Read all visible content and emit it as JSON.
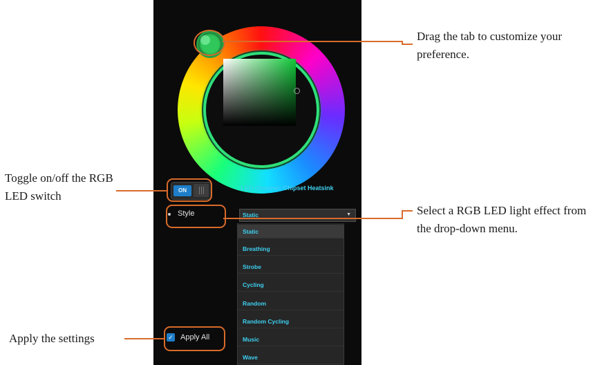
{
  "colors": {
    "panel_bg": "#0b0b0b",
    "accent": "#3ed0f0",
    "highlight": "#d96b2a",
    "toggle_on": "#1e7ec9",
    "ring_glow": "#2fe07a"
  },
  "app": {
    "color_wheel": {
      "hue_tab_icon": "circle-handle-icon",
      "picker_icon": "crosshair-icon"
    },
    "toggle": {
      "label": "ON"
    },
    "led_channel": "LED Channel: Chipset Heatsink",
    "style": {
      "label": "Style",
      "selected": "Static",
      "arrow_icon": "chevron-down-icon"
    },
    "dropdown_options": [
      "Static",
      "Breathing",
      "Strobe",
      "Cycling",
      "Random",
      "Random Cycling",
      "Music",
      "Wave"
    ],
    "apply": {
      "label": "Apply All",
      "checked": true,
      "icon": "check-icon"
    }
  },
  "annotations": {
    "drag_tab": "Drag the tab to customize your preference.",
    "toggle": "Toggle on/off the RGB LED switch",
    "select_effect": "Select a RGB LED light effect from the drop-down menu.",
    "apply": "Apply the settings"
  }
}
